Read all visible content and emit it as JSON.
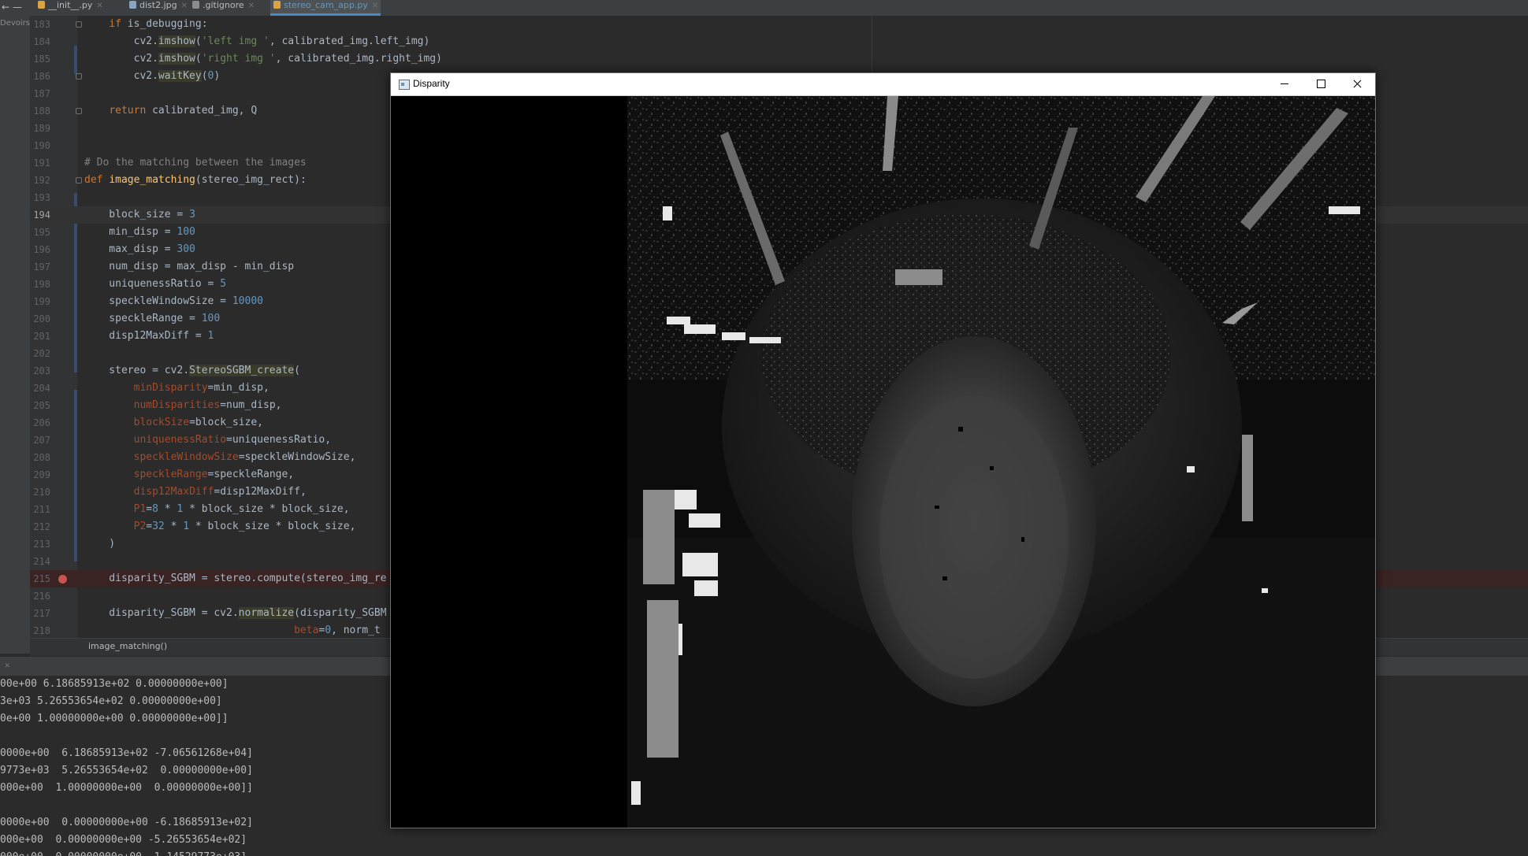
{
  "tabs": [
    {
      "label": "__init__.py",
      "active": false,
      "icon": "python-file-icon",
      "color": "#d9a441"
    },
    {
      "label": "dist2.jpg",
      "active": false,
      "icon": "image-file-icon",
      "color": "#8aa4bf"
    },
    {
      "label": ".gitignore",
      "active": false,
      "icon": "gitignore-file-icon",
      "color": "#8c8c8c"
    },
    {
      "label": "stereo_cam_app.py",
      "active": true,
      "icon": "python-file-icon",
      "color": "#d9a441"
    }
  ],
  "window_controls": {
    "back": "←",
    "menu": "—"
  },
  "left_panel_label": "Devoirs",
  "editor": {
    "current_line": 194,
    "breakpoint_line": 215,
    "lines": [
      {
        "n": "183",
        "text": "    if is_debugging:"
      },
      {
        "n": "184",
        "text": "        cv2.imshow('left img ', calibrated_img.left_img)"
      },
      {
        "n": "185",
        "text": "        cv2.imshow('right img ', calibrated_img.right_img)"
      },
      {
        "n": "186",
        "text": "        cv2.waitKey(0)"
      },
      {
        "n": "187",
        "text": ""
      },
      {
        "n": "188",
        "text": "    return calibrated_img, Q"
      },
      {
        "n": "189",
        "text": ""
      },
      {
        "n": "190",
        "text": ""
      },
      {
        "n": "191",
        "text": "# Do the matching between the images"
      },
      {
        "n": "192",
        "text": "def image_matching(stereo_img_rect):"
      },
      {
        "n": "193",
        "text": ""
      },
      {
        "n": "194",
        "text": "    block_size = 3"
      },
      {
        "n": "195",
        "text": "    min_disp = 100"
      },
      {
        "n": "196",
        "text": "    max_disp = 300"
      },
      {
        "n": "197",
        "text": "    num_disp = max_disp - min_disp"
      },
      {
        "n": "198",
        "text": "    uniquenessRatio = 5"
      },
      {
        "n": "199",
        "text": "    speckleWindowSize = 10000"
      },
      {
        "n": "200",
        "text": "    speckleRange = 100"
      },
      {
        "n": "201",
        "text": "    disp12MaxDiff = 1"
      },
      {
        "n": "202",
        "text": ""
      },
      {
        "n": "203",
        "text": "    stereo = cv2.StereoSGBM_create("
      },
      {
        "n": "204",
        "text": "        minDisparity=min_disp,"
      },
      {
        "n": "205",
        "text": "        numDisparities=num_disp,"
      },
      {
        "n": "206",
        "text": "        blockSize=block_size,"
      },
      {
        "n": "207",
        "text": "        uniquenessRatio=uniquenessRatio,"
      },
      {
        "n": "208",
        "text": "        speckleWindowSize=speckleWindowSize,"
      },
      {
        "n": "209",
        "text": "        speckleRange=speckleRange,"
      },
      {
        "n": "210",
        "text": "        disp12MaxDiff=disp12MaxDiff,"
      },
      {
        "n": "211",
        "text": "        P1=8 * 1 * block_size * block_size,"
      },
      {
        "n": "212",
        "text": "        P2=32 * 1 * block_size * block_size,"
      },
      {
        "n": "213",
        "text": "    )"
      },
      {
        "n": "214",
        "text": ""
      },
      {
        "n": "215",
        "text": "    disparity_SGBM = stereo.compute(stereo_img_re"
      },
      {
        "n": "216",
        "text": ""
      },
      {
        "n": "217",
        "text": "    disparity_SGBM = cv2.normalize(disparity_SGBM"
      },
      {
        "n": "218",
        "text": "                                  beta=0, norm_t"
      }
    ]
  },
  "breadcrumb": "image_matching()",
  "console": {
    "lines": [
      "00e+00 6.18685913e+02 0.00000000e+00]",
      "3e+03 5.26553654e+02 0.00000000e+00]",
      "0e+00 1.00000000e+00 0.00000000e+00]]",
      "",
      "0000e+00  6.18685913e+02 -7.06561268e+04]",
      "9773e+03  5.26553654e+02  0.00000000e+00]",
      "000e+00  1.00000000e+00  0.00000000e+00]]",
      "",
      "0000e+00  0.00000000e+00 -6.18685913e+02]",
      "000e+00  0.00000000e+00 -5.26553654e+02]",
      "000e+00  0.00000000e+00  1.14529773e+03]"
    ]
  },
  "disparity_window": {
    "title": "Disparity",
    "controls": {
      "minimize": "minimize",
      "maximize": "maximize",
      "close": "close"
    }
  }
}
